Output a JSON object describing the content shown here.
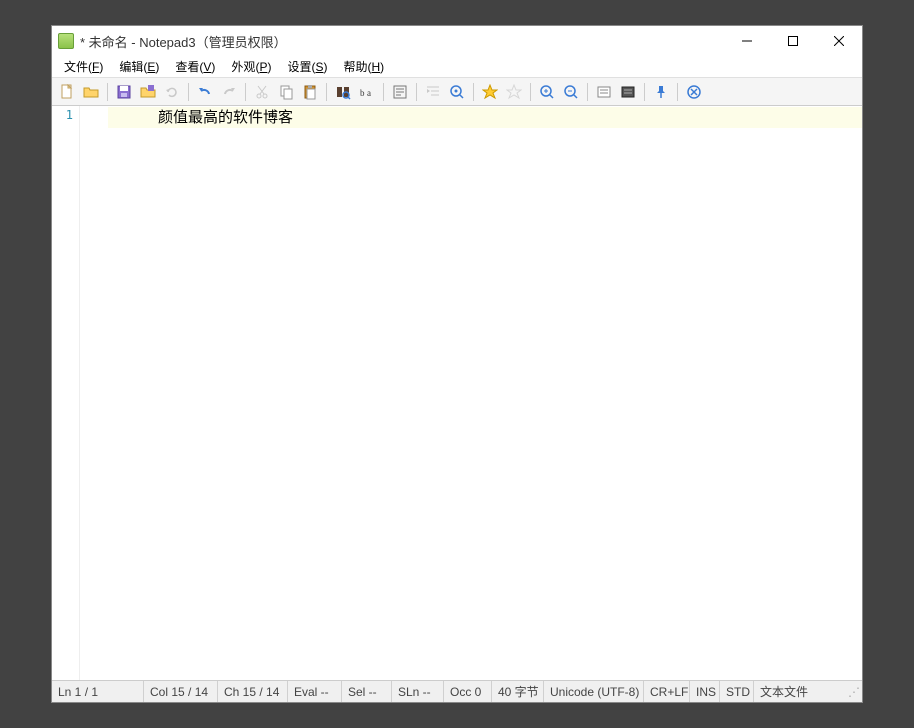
{
  "title": "* 未命名 - Notepad3（管理员权限）",
  "menu": {
    "file": {
      "label": "文件",
      "hotkey": "F"
    },
    "edit": {
      "label": "编辑",
      "hotkey": "E"
    },
    "view": {
      "label": "查看",
      "hotkey": "V"
    },
    "appearance": {
      "label": "外观",
      "hotkey": "P"
    },
    "settings": {
      "label": "设置",
      "hotkey": "S"
    },
    "help": {
      "label": "帮助",
      "hotkey": "H"
    }
  },
  "editor": {
    "line_number": "1",
    "line1_text": "颜值最高的软件博客"
  },
  "status": {
    "ln": "Ln  1 / 1",
    "col": "Col  15 / 14",
    "ch": "Ch  15 / 14",
    "eval": "Eval  --",
    "sel": "Sel  --",
    "sln": "SLn  --",
    "occ": "Occ  0",
    "bytes": "40 字节",
    "enc": "Unicode (UTF-8)",
    "eol": "CR+LF",
    "ovr": "INS",
    "mode": "STD",
    "scheme": "文本文件"
  }
}
